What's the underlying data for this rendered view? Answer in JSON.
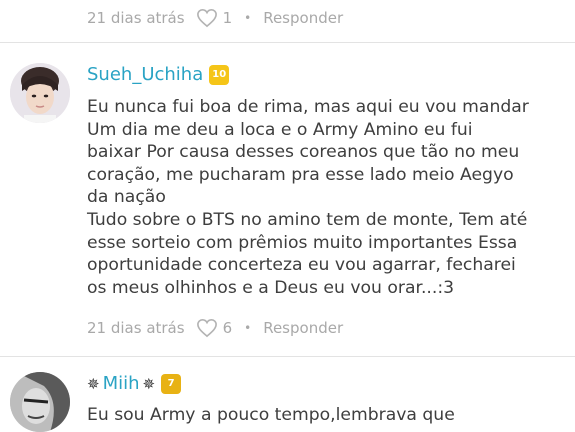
{
  "comments": [
    {
      "timestamp": "21 dias atrás",
      "likes": "1",
      "reply_label": "Responder",
      "dot": "•"
    },
    {
      "username": "Sueh_Uchiha",
      "level": "10",
      "level_color": "#f5c518",
      "text": "Eu nunca fui boa de rima, mas aqui eu vou mandar\nUm dia me deu a loca e o Army Amino eu fui\nbaixar Por causa desses coreanos que tão no meu\ncoração, me pucharam pra esse lado meio Aegyo\nda nação\nTudo sobre o BTS no amino tem de monte, Tem até\nesse sorteio com prêmios muito importantes Essa\noportunidade concerteza eu vou agarrar, fecharei\nos meus olhinhos e a Deus eu vou orar...:3",
      "timestamp": "21 dias atrás",
      "likes": "6",
      "reply_label": "Responder",
      "dot": "•"
    },
    {
      "username": "Miih",
      "prefix_glyph": "✵",
      "suffix_glyph": "✵",
      "level": "7",
      "level_color": "#e8b214",
      "text": "Eu sou Army a pouco tempo,lembrava que"
    }
  ],
  "colors": {
    "username": "#2aa3c4",
    "meta": "#a9a9a9",
    "divider": "#e3e3e3"
  }
}
